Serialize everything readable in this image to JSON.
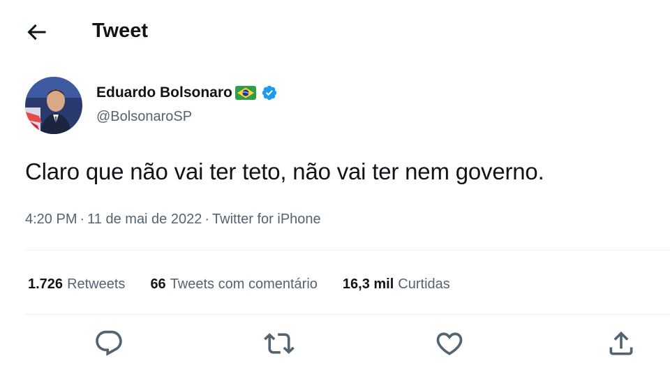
{
  "header": {
    "title": "Tweet",
    "back_icon": "arrow-left-icon"
  },
  "author": {
    "display_name": "Eduardo Bolsonaro",
    "handle": "@BolsonaroSP",
    "flag_icon": "brazil-flag-icon",
    "verified_icon": "verified-badge-icon",
    "verified_color": "#1d9bf0"
  },
  "tweet": {
    "text": "Claro que não vai ter teto, não vai ter nem governo.",
    "time": "4:20 PM",
    "date": "11 de mai de 2022",
    "source": "Twitter for iPhone",
    "separator": "·"
  },
  "stats": [
    {
      "count": "1.726",
      "label": "Retweets"
    },
    {
      "count": "66",
      "label": "Tweets com comentário"
    },
    {
      "count": "16,3 mil",
      "label": "Curtidas"
    }
  ],
  "actions": [
    {
      "icon": "reply-icon"
    },
    {
      "icon": "retweet-icon"
    },
    {
      "icon": "like-icon"
    },
    {
      "icon": "share-icon"
    }
  ],
  "colors": {
    "text": "#0f1419",
    "secondary": "#536471",
    "accent": "#1d9bf0",
    "divider": "#eff3f4"
  }
}
